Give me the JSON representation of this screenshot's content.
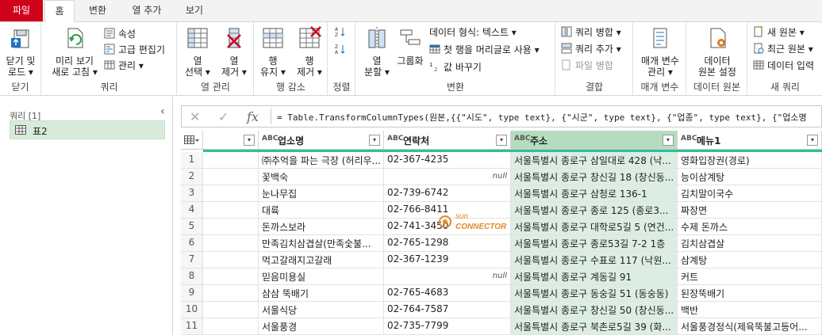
{
  "tabs": [
    "파일",
    "홈",
    "변환",
    "열 추가",
    "보기"
  ],
  "ribbon": {
    "groups": {
      "close": "닫기",
      "query": "쿼리",
      "manage_cols": "열 관리",
      "reduce_rows": "행 감소",
      "sort": "정렬",
      "transform": "변환",
      "combine": "결합",
      "params": "매개 변수",
      "datasource": "데이터 원본",
      "newquery": "새 쿼리"
    },
    "close_load": [
      "닫기 및",
      "로드 ▾"
    ],
    "refresh_preview": [
      "미리 보기",
      "새로 고침 ▾"
    ],
    "properties": "속성",
    "advanced_editor": "고급 편집기",
    "manage": "관리 ▾",
    "choose_cols": [
      "열",
      "선택 ▾"
    ],
    "remove_cols": [
      "열",
      "제거 ▾"
    ],
    "keep_rows": [
      "행",
      "유지 ▾"
    ],
    "remove_rows": [
      "행",
      "제거 ▾"
    ],
    "split_col": [
      "열",
      "분할 ▾"
    ],
    "group_by": "그룹화",
    "data_type": "데이터 형식: 텍스트 ▾",
    "first_row_header": "첫 행을 머리글로 사용 ▾",
    "replace_values": "값 바꾸기",
    "merge_queries": "쿼리 병합 ▾",
    "append_queries": "쿼리 추가 ▾",
    "combine_files": "파일 병합",
    "manage_params": [
      "매개 변수",
      "관리 ▾"
    ],
    "datasource_settings": [
      "데이터",
      "원본 설정"
    ],
    "new_source": "새 원본 ▾",
    "recent_sources": "최근 원본 ▾",
    "enter_data": "데이터 입력"
  },
  "queries_pane": {
    "title": "쿼리 [1]",
    "item": "표2"
  },
  "formula": {
    "fx": "fx",
    "text": "= Table.TransformColumnTypes(원본,{{\"시도\", type text}, {\"시군\", type text}, {\"업종\", type text}, {\"업소명"
  },
  "table": {
    "columns": [
      {
        "type": "ABC",
        "name": "업소명"
      },
      {
        "type": "ABC",
        "name": "연락처"
      },
      {
        "type": "ABC",
        "name": "주소"
      },
      {
        "type": "ABC",
        "name": "메뉴1"
      }
    ],
    "rows": [
      [
        "1",
        "㈜추억을 파는 극장 (허리우...",
        "02-367-4235",
        "서울특별시 종로구 삼일대로 428 (낙...",
        "영화입장권(경로)"
      ],
      [
        "2",
        "꽃백숙",
        "null",
        "서울특별시 종로구 창신길 18 (창신동...",
        "능이삼계탕"
      ],
      [
        "3",
        "눈나무집",
        "02-739-6742",
        "서울특별시 종로구 삼청로 136-1",
        "김치말이국수"
      ],
      [
        "4",
        "대륙",
        "02-766-8411",
        "서울특별시 종로구 종로 125 (종로3...",
        "짜장면"
      ],
      [
        "5",
        "돈까스보라",
        "02-741-3450",
        "서울특별시 종로구 대학로5길 5 (연건...",
        "수제 돈까스"
      ],
      [
        "6",
        "만족김치삼겹살(만족숯불...",
        "02-765-1298",
        "서울특별시 종로구 종로53길 7-2 1층",
        "김치삼겹살"
      ],
      [
        "7",
        "먹고갈래지고갈래",
        "02-367-1239",
        "서울특별시 종로구 수표로 117 (낙원...",
        "삼계탕"
      ],
      [
        "8",
        "믿음미용실",
        "null",
        "서울특별시 종로구 계동길 91",
        "커트"
      ],
      [
        "9",
        "삼삼 뚝배기",
        "02-765-4683",
        "서울특별시 종로구 동숭길 51 (동숭동)",
        "된장뚝배기"
      ],
      [
        "10",
        "서울식당",
        "02-764-7587",
        "서울특별시 종로구 창신길 50 (창신동...",
        "백반"
      ],
      [
        "11",
        "서울풍경",
        "02-735-7799",
        "서울특별시 종로구 북촌로5길 39 (화...",
        "서울풍경정식(제육뚝불고등어..."
      ]
    ]
  },
  "watermark": {
    "line1": "sun",
    "line2": "CONNECTOR"
  },
  "colors": {
    "file_tab": "#d0021b",
    "selected_col": "#b6dcc0",
    "quality_bar": "#2fbf9a",
    "query_item": "#d6ecd9"
  }
}
